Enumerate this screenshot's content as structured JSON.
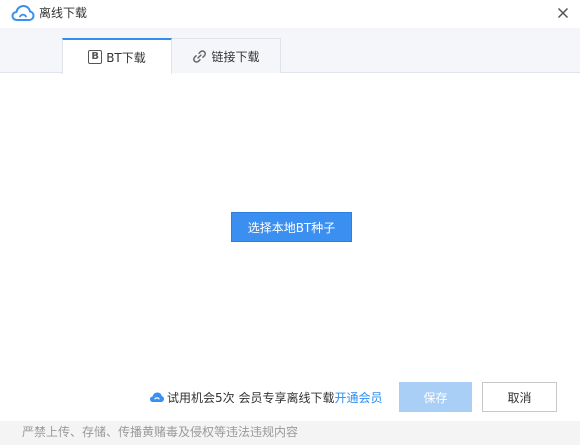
{
  "window": {
    "title": "离线下载",
    "logo_icon": "cloud-logo-icon",
    "close_icon": "close-icon"
  },
  "tabs": [
    {
      "label": "BT下载",
      "icon": "bt-icon",
      "icon_text": "B",
      "active": true
    },
    {
      "label": "链接下载",
      "icon": "link-icon",
      "active": false
    }
  ],
  "main": {
    "select_button_label": "选择本地BT种子"
  },
  "footer": {
    "promo_text": "试用机会5次 会员专享离线下载",
    "promo_link": "开通会员",
    "save_label": "保存",
    "cancel_label": "取消",
    "notice": "严禁上传、存储、传播黄赌毒及侵权等违法违规内容"
  },
  "colors": {
    "accent": "#3b8ff0",
    "link": "#2f8ef0",
    "disabled_button": "#a9cff7",
    "notice_text": "#9a9a9a"
  }
}
